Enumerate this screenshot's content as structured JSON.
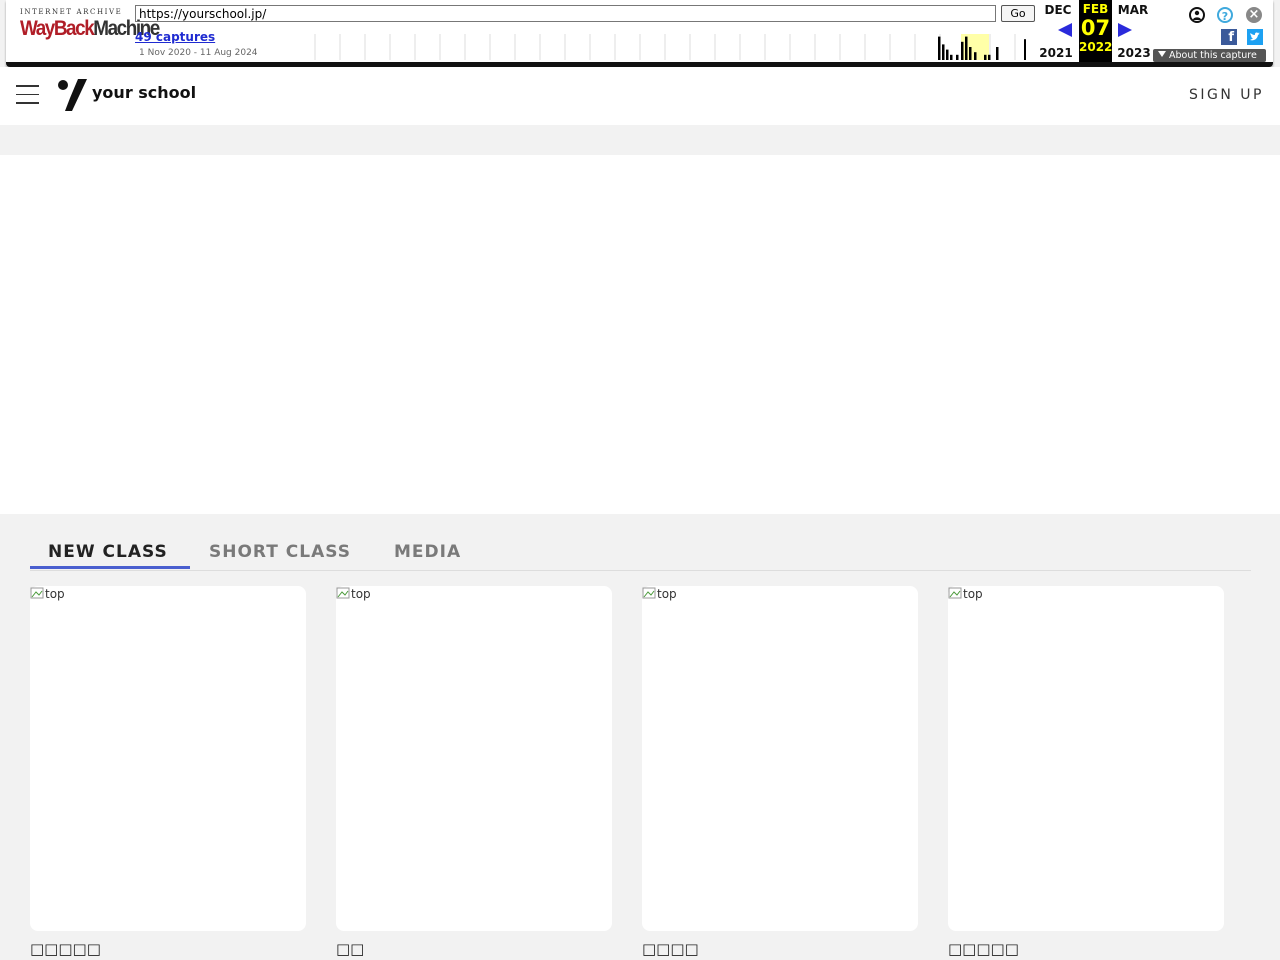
{
  "wayback": {
    "logo_top": "INTERNET ARCHIVE",
    "logo_wayback": "WayBack",
    "logo_machine": "Machine",
    "url": "https://yourschool.jp/",
    "go_label": "Go",
    "captures": "49 captures",
    "date_range": "1 Nov 2020 - 11 Aug 2024",
    "prev_month": "DEC",
    "cur_month": "FEB",
    "next_month": "MAR",
    "cur_day": "07",
    "prev_year": "2021",
    "cur_year": "2022",
    "next_year": "2023",
    "help_glyph": "?",
    "close_glyph": "×",
    "facebook_glyph": "f",
    "about_label": "About this capture",
    "sparkline_levels": [
      0,
      0,
      0,
      0,
      0,
      0,
      0,
      0,
      0,
      0,
      0,
      0,
      0,
      0,
      0,
      0,
      0,
      0,
      0,
      0,
      0,
      0,
      0,
      0,
      0.9,
      0.5,
      0.3,
      0.2,
      0.7,
      0.9,
      0.4,
      0.2,
      0.2,
      0.5,
      0.9
    ],
    "colors": {
      "accent": "#b01d27",
      "highlight": "#ffff00",
      "link": "#1f2bd1"
    }
  },
  "header": {
    "logo_text": "your school",
    "signup_label": "SIGN UP"
  },
  "tabs": [
    {
      "label": "NEW CLASS",
      "active": true
    },
    {
      "label": "SHORT CLASS",
      "active": false
    },
    {
      "label": "MEDIA",
      "active": false
    }
  ],
  "cards": [
    {
      "image_alt": "top",
      "title": "□□□□□"
    },
    {
      "image_alt": "top",
      "title": "□□"
    },
    {
      "image_alt": "top",
      "title": "□□□□"
    },
    {
      "image_alt": "top",
      "title": "□□□□□"
    }
  ],
  "colors": {
    "tab_accent": "#4a5fcf",
    "page_bg": "#f2f2f2"
  }
}
